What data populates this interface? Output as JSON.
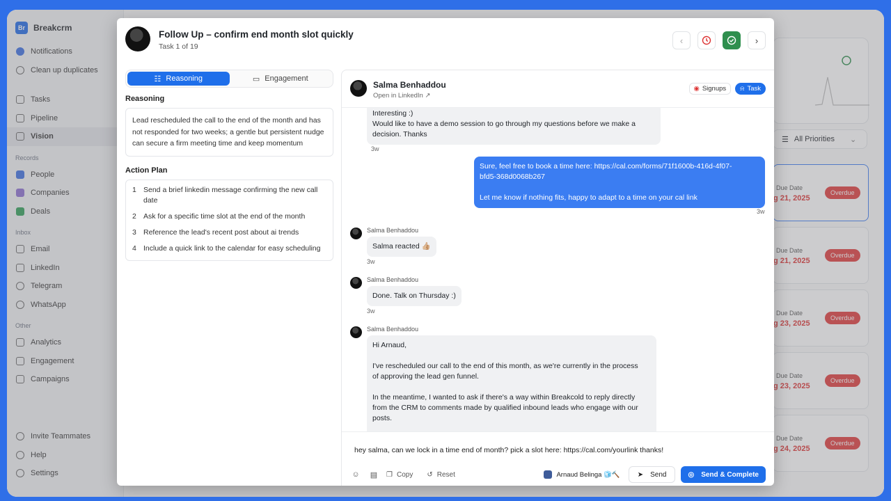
{
  "app": {
    "brand_short": "Br",
    "brand_name": "Breakcrm"
  },
  "sidebar": {
    "top": [
      {
        "label": "Notifications"
      },
      {
        "label": "Clean up duplicates"
      }
    ],
    "main": [
      {
        "label": "Tasks"
      },
      {
        "label": "Pipeline"
      },
      {
        "label": "Vision"
      }
    ],
    "records_title": "Records",
    "records": [
      {
        "label": "People"
      },
      {
        "label": "Companies"
      },
      {
        "label": "Deals"
      }
    ],
    "inbox_title": "Inbox",
    "inbox": [
      {
        "label": "Email"
      },
      {
        "label": "LinkedIn"
      },
      {
        "label": "Telegram"
      },
      {
        "label": "WhatsApp"
      }
    ],
    "other_title": "Other",
    "other": [
      {
        "label": "Analytics"
      },
      {
        "label": "Engagement"
      },
      {
        "label": "Campaigns"
      }
    ],
    "bottom": [
      {
        "label": "Invite Teammates"
      },
      {
        "label": "Help"
      },
      {
        "label": "Settings"
      }
    ]
  },
  "background": {
    "priority_filter": "All Priorities",
    "due_label": "Due Date",
    "overdue_label": "Overdue",
    "tasks": [
      {
        "date": "g 21, 2025"
      },
      {
        "date": "g 21, 2025"
      },
      {
        "date": "g 23, 2025"
      },
      {
        "date": "g 23, 2025"
      },
      {
        "date": "g 24, 2025"
      }
    ]
  },
  "modal": {
    "title": "Follow Up – confirm end month slot quickly",
    "subtitle": "Task 1 of 19",
    "tabs": {
      "reasoning": "Reasoning",
      "engagement": "Engagement"
    },
    "reasoning_label": "Reasoning",
    "reasoning_text": "Lead rescheduled the call to the end of the month and has not responded for two weeks; a gentle but persistent nudge can secure a firm meeting time and keep momentum",
    "action_plan_label": "Action Plan",
    "action_plan": [
      {
        "num": "1",
        "text": "Send a brief linkedin message confirming the new call date"
      },
      {
        "num": "2",
        "text": "Ask for a specific time slot at the end of the month"
      },
      {
        "num": "3",
        "text": "Reference the lead's recent post about ai trends"
      },
      {
        "num": "4",
        "text": "Include a quick link to the calendar for easy scheduling"
      }
    ]
  },
  "contact": {
    "name": "Salma Benhaddou",
    "link": "Open in LinkedIn",
    "tags": {
      "signups": "Signups",
      "task": "Task"
    }
  },
  "thread": {
    "msg1": {
      "lines": [
        "Interesting :)",
        "Would like to have a demo session to go through my questions before we make a",
        "decision. Thanks"
      ],
      "time": "3w"
    },
    "msg2": {
      "lines": [
        "Sure, feel free to book a time here: https://cal.com/forms/71f1600b-416d-4f07-",
        "bfd5-368d0068b267",
        "",
        "Let me know if nothing fits, happy to adapt to a time on your cal link"
      ],
      "time": "3w"
    },
    "msg3": {
      "sender": "Salma Benhaddou",
      "text": "Salma reacted 👍🏼",
      "time": "3w"
    },
    "msg4": {
      "sender": "Salma Benhaddou",
      "text": "Done. Talk on Thursday :)",
      "time": "3w"
    },
    "msg5": {
      "sender": "Salma Benhaddou",
      "lines": [
        "Hi Arnaud,",
        "",
        "I've rescheduled our call to the end of this month, as we're currently in the process",
        "of approving the lead gen funnel.",
        "",
        "In the meantime, I wanted to ask if there's a way within Breakcold to reply directly",
        "from the CRM to comments made by qualified inbound leads who engage with our",
        "posts."
      ]
    }
  },
  "composer": {
    "draft": "hey salma, can we lock in a time end of month? pick a slot here: https://cal.com/yourlink thanks!",
    "copy": "Copy",
    "reset": "Reset",
    "sender": "Arnaud Belinga 🧊🔨",
    "send": "Send",
    "send_complete": "Send & Complete"
  }
}
